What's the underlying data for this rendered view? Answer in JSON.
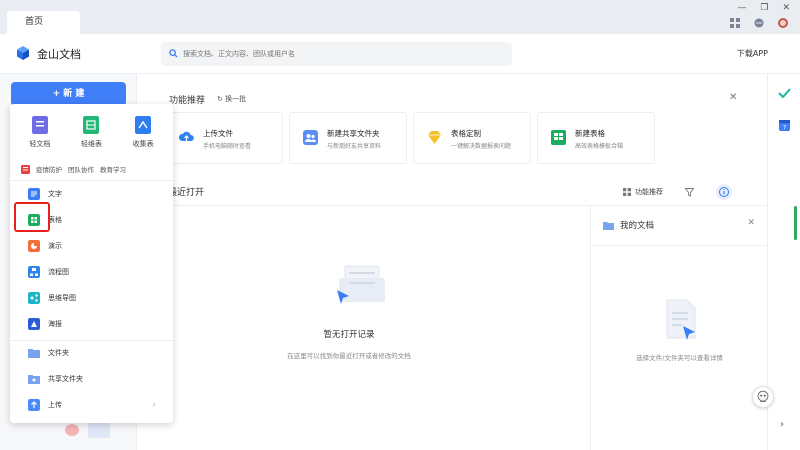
{
  "tabs": {
    "home": "首页"
  },
  "header": {
    "brand": "金山文档",
    "search_placeholder": "搜索文档、正文内容、团队或用户名",
    "download": "下载APP"
  },
  "sidebar": {
    "new_button": "+ 新 建"
  },
  "new_menu": {
    "top": [
      {
        "label": "轻文档",
        "color": "#6f6be4"
      },
      {
        "label": "轻维表",
        "color": "#24b877"
      },
      {
        "label": "收集表",
        "color": "#2f7ff3"
      }
    ],
    "tags": [
      "疫情防护",
      "团队协作",
      "教育学习"
    ],
    "items": [
      {
        "label": "文字",
        "color": "#3a7df6"
      },
      {
        "label": "表格",
        "color": "#1aad5e"
      },
      {
        "label": "演示",
        "color": "#f26f3c"
      },
      {
        "label": "流程图",
        "color": "#2d85f0"
      },
      {
        "label": "思维导图",
        "color": "#18b6c7"
      },
      {
        "label": "海报",
        "color": "#2b5bd7"
      },
      {
        "label": "文件夹",
        "color": "#7aa3ef"
      },
      {
        "label": "共享文件夹",
        "color": "#7aa3ef"
      },
      {
        "label": "上传",
        "color": "#4a8cf7"
      }
    ]
  },
  "features": {
    "title": "功能推荐",
    "refresh": "换一批",
    "cards": [
      {
        "title": "上传文件",
        "subtitle": "手机电脑随时查看",
        "color": "#2f82f5"
      },
      {
        "title": "新建共享文件夹",
        "subtitle": "与新朋好友共享资料",
        "color": "#5b8ef5"
      },
      {
        "title": "表格定制",
        "subtitle": "一键解决数据报表问题",
        "color": "#f6c12a"
      },
      {
        "title": "新建表格",
        "subtitle": "高效表格模板合辑",
        "color": "#1aad5e"
      }
    ]
  },
  "recent": {
    "label": "最近打开",
    "feature_btn": "功能推荐",
    "empty_title": "暂无打开记录",
    "empty_sub": "在这里可以找到你最近打开或者修改的文档"
  },
  "my_docs": {
    "title": "我的文档",
    "hint": "选择文件/文件夹可以查看详情"
  },
  "colors": {
    "accent": "#417ff9",
    "highlight": "#e3221c"
  }
}
